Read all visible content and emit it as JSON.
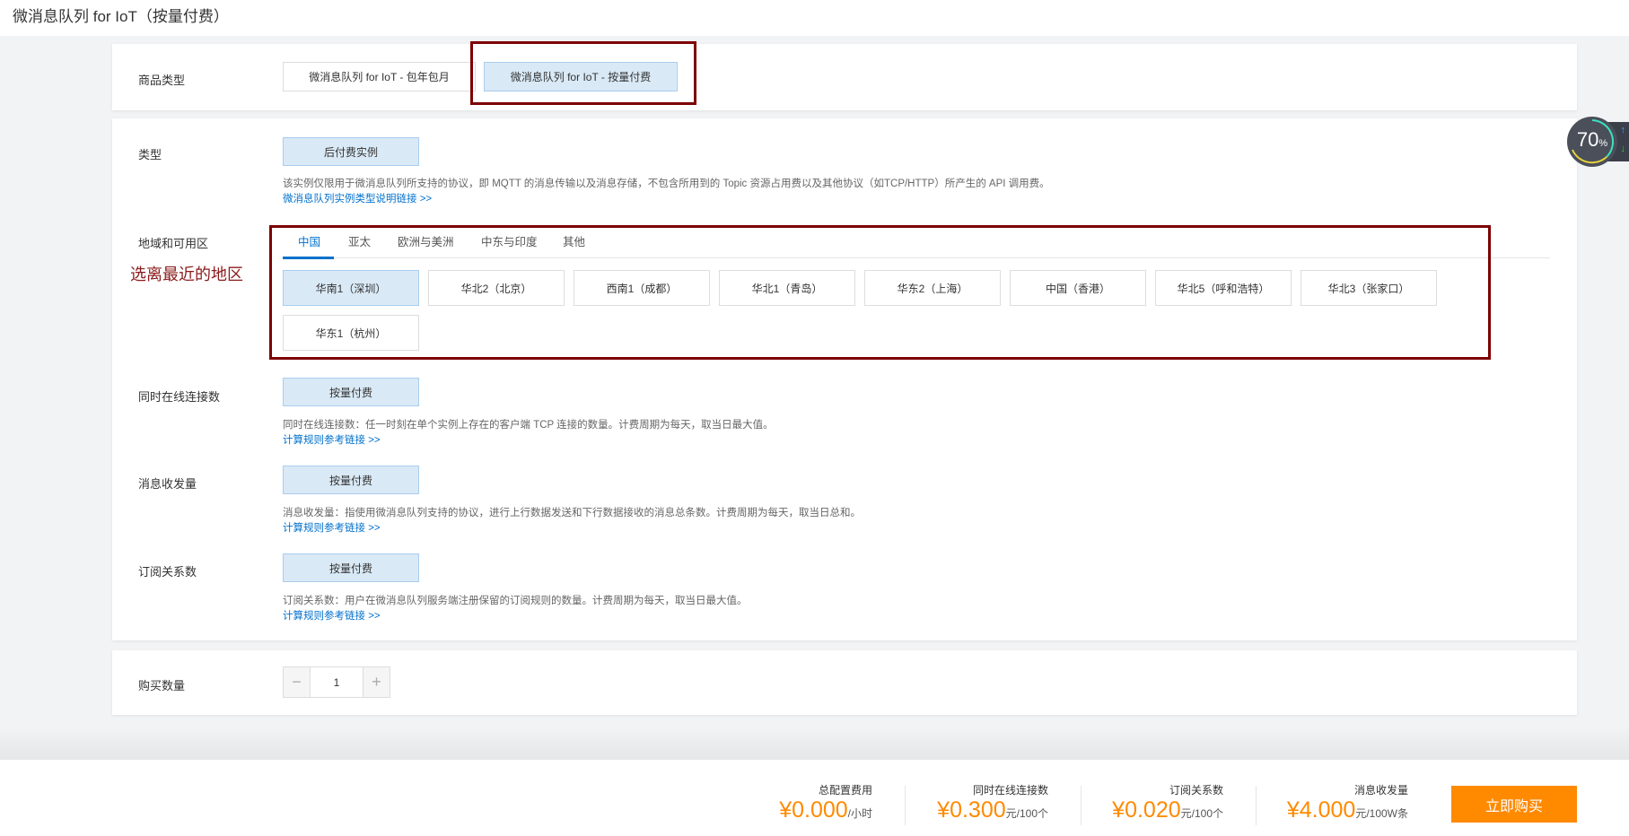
{
  "header": {
    "title": "微消息队列 for IoT（按量付费）"
  },
  "product_type": {
    "label": "商品类型",
    "options": [
      "微消息队列 for IoT - 包年包月",
      "微消息队列 for IoT - 按量付费"
    ]
  },
  "type": {
    "label": "类型",
    "option": "后付费实例",
    "desc": "该实例仅限用于微消息队列所支持的协议，即 MQTT 的消息传输以及消息存储，不包含所用到的 Topic 资源占用费以及其他协议（如TCP/HTTP）所产生的 API 调用费。",
    "link": "微消息队列实例类型说明链接 >>"
  },
  "region": {
    "label": "地域和可用区",
    "annotation": "选离最近的地区",
    "tabs": [
      "中国",
      "亚太",
      "欧洲与美洲",
      "中东与印度",
      "其他"
    ],
    "options": [
      "华南1（深圳）",
      "华北2（北京）",
      "西南1（成都）",
      "华北1（青岛）",
      "华东2（上海）",
      "中国（香港）",
      "华北5（呼和浩特）",
      "华北3（张家口）",
      "华东1（杭州）"
    ]
  },
  "connections": {
    "label": "同时在线连接数",
    "option": "按量付费",
    "desc": "同时在线连接数：任一时刻在单个实例上存在的客户端 TCP 连接的数量。计费周期为每天，取当日最大值。",
    "link": "计算规则参考链接 >>"
  },
  "messages": {
    "label": "消息收发量",
    "option": "按量付费",
    "desc": "消息收发量：指使用微消息队列支持的协议，进行上行数据发送和下行数据接收的消息总条数。计费周期为每天，取当日总和。",
    "link": "计算规则参考链接 >>"
  },
  "subscriptions": {
    "label": "订阅关系数",
    "option": "按量付费",
    "desc": "订阅关系数：用户在微消息队列服务端注册保留的订阅规则的数量。计费周期为每天，取当日最大值。",
    "link": "计算规则参考链接 >>"
  },
  "quantity": {
    "label": "购买数量",
    "value": "1",
    "minus": "−",
    "plus": "+"
  },
  "widget": {
    "percent": "70",
    "unit": "%"
  },
  "footer": {
    "items": [
      {
        "label": "总配置费用",
        "price": "¥0.000",
        "unit": "/小时"
      },
      {
        "label": "同时在线连接数",
        "price": "¥0.300",
        "unit": "元/100个"
      },
      {
        "label": "订阅关系数",
        "price": "¥0.020",
        "unit": "元/100个"
      },
      {
        "label": "消息收发量",
        "price": "¥4.000",
        "unit": "元/100W条"
      }
    ],
    "buy": "立即购买"
  },
  "colors": {
    "accent": "#0070cc",
    "price": "#ff8a00",
    "annotation": "#7d0000"
  }
}
